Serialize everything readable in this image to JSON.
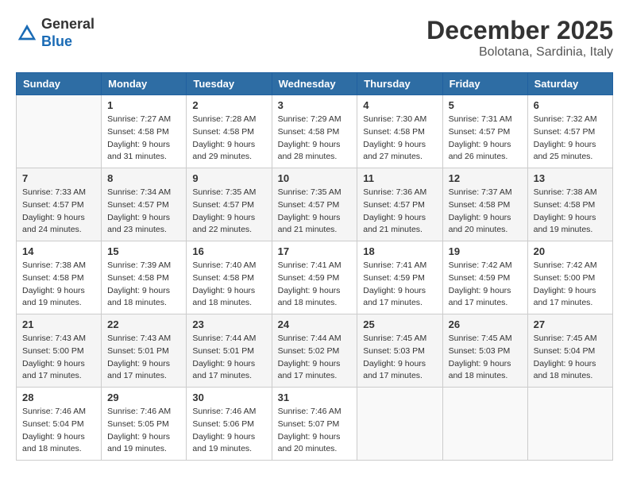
{
  "header": {
    "logo_general": "General",
    "logo_blue": "Blue",
    "month": "December 2025",
    "location": "Bolotana, Sardinia, Italy"
  },
  "weekdays": [
    "Sunday",
    "Monday",
    "Tuesday",
    "Wednesday",
    "Thursday",
    "Friday",
    "Saturday"
  ],
  "weeks": [
    [
      {
        "day": "",
        "sunrise": "",
        "sunset": "",
        "daylight": ""
      },
      {
        "day": "1",
        "sunrise": "Sunrise: 7:27 AM",
        "sunset": "Sunset: 4:58 PM",
        "daylight": "Daylight: 9 hours and 31 minutes."
      },
      {
        "day": "2",
        "sunrise": "Sunrise: 7:28 AM",
        "sunset": "Sunset: 4:58 PM",
        "daylight": "Daylight: 9 hours and 29 minutes."
      },
      {
        "day": "3",
        "sunrise": "Sunrise: 7:29 AM",
        "sunset": "Sunset: 4:58 PM",
        "daylight": "Daylight: 9 hours and 28 minutes."
      },
      {
        "day": "4",
        "sunrise": "Sunrise: 7:30 AM",
        "sunset": "Sunset: 4:58 PM",
        "daylight": "Daylight: 9 hours and 27 minutes."
      },
      {
        "day": "5",
        "sunrise": "Sunrise: 7:31 AM",
        "sunset": "Sunset: 4:57 PM",
        "daylight": "Daylight: 9 hours and 26 minutes."
      },
      {
        "day": "6",
        "sunrise": "Sunrise: 7:32 AM",
        "sunset": "Sunset: 4:57 PM",
        "daylight": "Daylight: 9 hours and 25 minutes."
      }
    ],
    [
      {
        "day": "7",
        "sunrise": "Sunrise: 7:33 AM",
        "sunset": "Sunset: 4:57 PM",
        "daylight": "Daylight: 9 hours and 24 minutes."
      },
      {
        "day": "8",
        "sunrise": "Sunrise: 7:34 AM",
        "sunset": "Sunset: 4:57 PM",
        "daylight": "Daylight: 9 hours and 23 minutes."
      },
      {
        "day": "9",
        "sunrise": "Sunrise: 7:35 AM",
        "sunset": "Sunset: 4:57 PM",
        "daylight": "Daylight: 9 hours and 22 minutes."
      },
      {
        "day": "10",
        "sunrise": "Sunrise: 7:35 AM",
        "sunset": "Sunset: 4:57 PM",
        "daylight": "Daylight: 9 hours and 21 minutes."
      },
      {
        "day": "11",
        "sunrise": "Sunrise: 7:36 AM",
        "sunset": "Sunset: 4:57 PM",
        "daylight": "Daylight: 9 hours and 21 minutes."
      },
      {
        "day": "12",
        "sunrise": "Sunrise: 7:37 AM",
        "sunset": "Sunset: 4:58 PM",
        "daylight": "Daylight: 9 hours and 20 minutes."
      },
      {
        "day": "13",
        "sunrise": "Sunrise: 7:38 AM",
        "sunset": "Sunset: 4:58 PM",
        "daylight": "Daylight: 9 hours and 19 minutes."
      }
    ],
    [
      {
        "day": "14",
        "sunrise": "Sunrise: 7:38 AM",
        "sunset": "Sunset: 4:58 PM",
        "daylight": "Daylight: 9 hours and 19 minutes."
      },
      {
        "day": "15",
        "sunrise": "Sunrise: 7:39 AM",
        "sunset": "Sunset: 4:58 PM",
        "daylight": "Daylight: 9 hours and 18 minutes."
      },
      {
        "day": "16",
        "sunrise": "Sunrise: 7:40 AM",
        "sunset": "Sunset: 4:58 PM",
        "daylight": "Daylight: 9 hours and 18 minutes."
      },
      {
        "day": "17",
        "sunrise": "Sunrise: 7:41 AM",
        "sunset": "Sunset: 4:59 PM",
        "daylight": "Daylight: 9 hours and 18 minutes."
      },
      {
        "day": "18",
        "sunrise": "Sunrise: 7:41 AM",
        "sunset": "Sunset: 4:59 PM",
        "daylight": "Daylight: 9 hours and 17 minutes."
      },
      {
        "day": "19",
        "sunrise": "Sunrise: 7:42 AM",
        "sunset": "Sunset: 4:59 PM",
        "daylight": "Daylight: 9 hours and 17 minutes."
      },
      {
        "day": "20",
        "sunrise": "Sunrise: 7:42 AM",
        "sunset": "Sunset: 5:00 PM",
        "daylight": "Daylight: 9 hours and 17 minutes."
      }
    ],
    [
      {
        "day": "21",
        "sunrise": "Sunrise: 7:43 AM",
        "sunset": "Sunset: 5:00 PM",
        "daylight": "Daylight: 9 hours and 17 minutes."
      },
      {
        "day": "22",
        "sunrise": "Sunrise: 7:43 AM",
        "sunset": "Sunset: 5:01 PM",
        "daylight": "Daylight: 9 hours and 17 minutes."
      },
      {
        "day": "23",
        "sunrise": "Sunrise: 7:44 AM",
        "sunset": "Sunset: 5:01 PM",
        "daylight": "Daylight: 9 hours and 17 minutes."
      },
      {
        "day": "24",
        "sunrise": "Sunrise: 7:44 AM",
        "sunset": "Sunset: 5:02 PM",
        "daylight": "Daylight: 9 hours and 17 minutes."
      },
      {
        "day": "25",
        "sunrise": "Sunrise: 7:45 AM",
        "sunset": "Sunset: 5:03 PM",
        "daylight": "Daylight: 9 hours and 17 minutes."
      },
      {
        "day": "26",
        "sunrise": "Sunrise: 7:45 AM",
        "sunset": "Sunset: 5:03 PM",
        "daylight": "Daylight: 9 hours and 18 minutes."
      },
      {
        "day": "27",
        "sunrise": "Sunrise: 7:45 AM",
        "sunset": "Sunset: 5:04 PM",
        "daylight": "Daylight: 9 hours and 18 minutes."
      }
    ],
    [
      {
        "day": "28",
        "sunrise": "Sunrise: 7:46 AM",
        "sunset": "Sunset: 5:04 PM",
        "daylight": "Daylight: 9 hours and 18 minutes."
      },
      {
        "day": "29",
        "sunrise": "Sunrise: 7:46 AM",
        "sunset": "Sunset: 5:05 PM",
        "daylight": "Daylight: 9 hours and 19 minutes."
      },
      {
        "day": "30",
        "sunrise": "Sunrise: 7:46 AM",
        "sunset": "Sunset: 5:06 PM",
        "daylight": "Daylight: 9 hours and 19 minutes."
      },
      {
        "day": "31",
        "sunrise": "Sunrise: 7:46 AM",
        "sunset": "Sunset: 5:07 PM",
        "daylight": "Daylight: 9 hours and 20 minutes."
      },
      {
        "day": "",
        "sunrise": "",
        "sunset": "",
        "daylight": ""
      },
      {
        "day": "",
        "sunrise": "",
        "sunset": "",
        "daylight": ""
      },
      {
        "day": "",
        "sunrise": "",
        "sunset": "",
        "daylight": ""
      }
    ]
  ]
}
